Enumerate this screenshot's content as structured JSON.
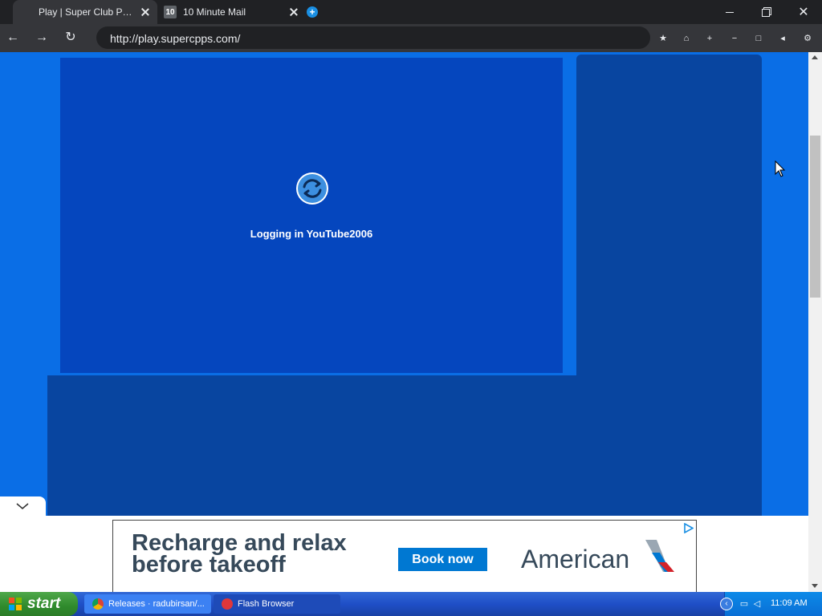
{
  "browser": {
    "tabs": [
      {
        "title": "Play | Super Club Penguin",
        "active": true
      },
      {
        "title": "10 Minute Mail",
        "favicon_text": "10",
        "active": false
      }
    ],
    "address": "http://play.supercpps.com/",
    "toolbar_icons": [
      "star-icon",
      "home-icon",
      "plus-icon",
      "minus-icon",
      "fullscreen-icon",
      "volume-icon",
      "settings-icon"
    ]
  },
  "game": {
    "status_text": "Logging in YouTube2006"
  },
  "ad": {
    "headline_line1": "Recharge and relax",
    "headline_line2": "before takeoff",
    "cta": "Book now",
    "brand": "American"
  },
  "taskbar": {
    "start_label": "start",
    "items": [
      {
        "label": "Releases · radubirsan/..."
      },
      {
        "label": "Flash Browser"
      }
    ],
    "clock": "11:09 AM"
  },
  "colors": {
    "page_bg": "#0a6ee6",
    "panel": "#0845a0",
    "game_area": "#0546be",
    "ad_cta": "#0078d2",
    "ad_text": "#36495a"
  }
}
